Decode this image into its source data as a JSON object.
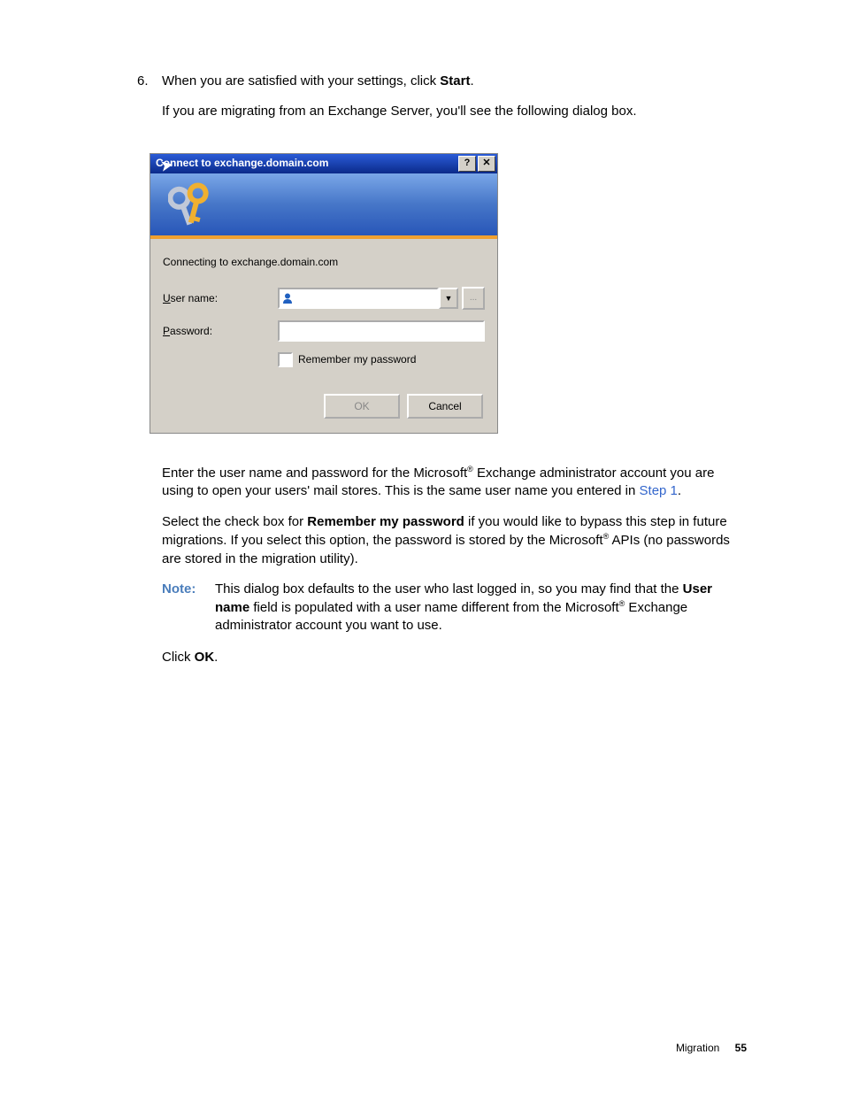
{
  "step": {
    "number": "6.",
    "line1a": "When you are satisfied with your settings, click ",
    "line1b": "Start",
    "line1c": ".",
    "line2": "If you are migrating from an Exchange Server, you'll see the following dialog box."
  },
  "dialog": {
    "title": "Connect to exchange.domain.com",
    "help": "?",
    "close": "✕",
    "connect_line": "Connecting to exchange.domain.com",
    "user_label_u": "U",
    "user_label_rest": "ser name:",
    "pwd_label_p": "P",
    "pwd_label_rest": "assword:",
    "remember_r": "R",
    "remember_rest": "emember my password",
    "ok": "OK",
    "cancel": "Cancel",
    "browse": "...",
    "arrow": "▼"
  },
  "para1": {
    "a": "Enter the user name and password for the ",
    "ms": "Microsoft",
    "reg": "®",
    "b": " Exchange administrator account you are using to open your users' mail stores. This is the same user name you entered in ",
    "link": "Step 1",
    "c": "."
  },
  "para2": {
    "a": "Select the check box for ",
    "bold": "Remember my password",
    "b": " if you would like to bypass this step in future migrations. If you select this option, the password is stored by the Microsoft",
    "reg": "®",
    "c": " APIs (no passwords are stored in the migration utility)."
  },
  "note": {
    "label": "Note:",
    "a": "This dialog box defaults to the user who last logged in, so you may find that the ",
    "bold": "User name",
    "b": " field is populated with a user name different from the ",
    "ms": "Microsoft",
    "reg": "®",
    "c": " Exchange administrator account you want to use."
  },
  "para3": {
    "a": "Click ",
    "bold": "OK",
    "b": "."
  },
  "footer": {
    "section": "Migration",
    "page": "55"
  }
}
